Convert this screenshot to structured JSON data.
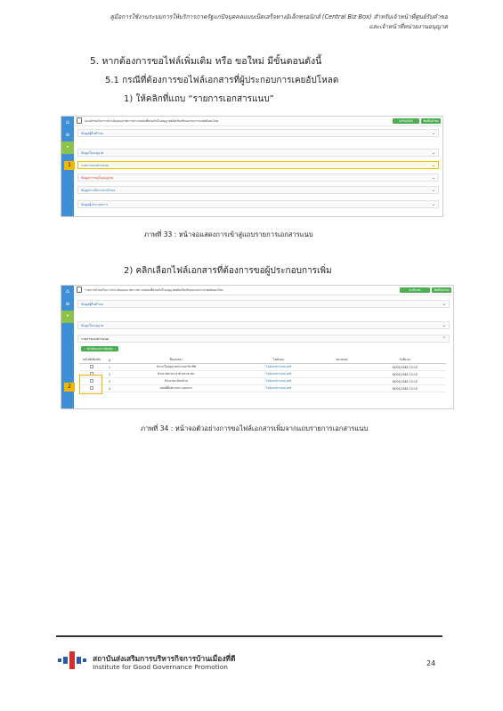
{
  "header": {
    "line1": "คู่มือการใช้งานระบบการให้บริการภาครัฐแก่ปัจบุคคลแบบเบ็ดเสร็จทางอิเล็กทรอนิกส์ (Central Biz Box) สำหรับเจ้าหน้าที่ศูนย์รับคำขอ",
    "line2": "และเจ้าหน้าที่หน่วยงานอนุญาต"
  },
  "sections": {
    "s5": "5. หากต้องการขอไฟล์เพิ่มเติม หรือ ขอใหม่ มีขั้นตอนดังนี้",
    "s51": "5.1 กรณีที่ต้องการขอไฟล์เอกสารที่ผู้ประกอบการเคยอัปโหลด",
    "step1": "1)  ให้คลิกที่แถบ “รายการเอกสารแนบ”",
    "step2": "2)  คลิกเลือกไฟล์เอกสารที่ต้องการขอผู้ประกอบการเพิ่ม"
  },
  "figure33": {
    "caption": "ภาพที่ 33 : หน้าจอแสดงการเข้าสู่แถบรายการเอกสารแนบ",
    "title": "แบบคำขอรับการประเมินคุณภาพการตรวจสอบเพื่อขอรับใบอนุญาตผลิตภัณฑ์ของกรมการแพทย์แผนไทย",
    "buttons": [
      "ส่งเรื่องถัดไป",
      "พิมพ์ใบคำขอ"
    ],
    "step_no": "1",
    "panels": [
      {
        "label": "ข้อมูลผู้ยื่นคำขอ",
        "style": "blue"
      },
      {
        "label": "ข้อมูลใบอนุญาต",
        "style": "blue"
      },
      {
        "label": "รายการเอกสารแนบ",
        "style": "highlight"
      },
      {
        "label": "ข้อมูลการขอใบอนุญาต",
        "style": "red"
      },
      {
        "label": "ข้อมูลการพิจารณาคำขอ",
        "style": "blue"
      },
      {
        "label": "ข้อมูลผู้ประกอบการ",
        "style": "blue"
      }
    ]
  },
  "figure34": {
    "caption": "ภาพที่ 34 : หน้าจอตัวอย่างการขอไฟล์เอกสารเพิ่มจากแถบรายการเอกสารแนบ",
    "title": "รายการคำขอรับการประเมินคุณภาพการตรวจสอบเพื่อขอรับใบอนุญาตผลิตภัณฑ์ของกรมการแพทย์แผนไทย",
    "buttons": [
      "ส่งเรื่องต่อ",
      "พิมพ์ใบคำขอ"
    ],
    "step_no": "2",
    "panels": [
      "ข้อมูลผู้ยื่นคำขอ",
      "ข้อมูลใบอนุญาต",
      "รายการเอกสารแนบ"
    ],
    "action_button": "ขอไฟล์เอกสารเพิ่มเติม",
    "table": {
      "headers": [
        "ขอไฟล์เพิ่มเติม",
        "#",
        "ชื่อเอกสาร",
        "ไฟล์แนบ",
        "หมายเหตุ",
        "วันที่แนบ"
      ],
      "rows": [
        [
          "1",
          "สำเนาใบอนุญาตประกอบวิชาชีพ",
          "ไฟล์เอกสารแนบ.pdf",
          "-",
          "16/05/2562 14:15"
        ],
        [
          "2",
          "สำเนาบัตรประจำตัวประชาชน",
          "ไฟล์เอกสารแนบ.pdf",
          "-",
          "16/05/2562 14:15"
        ],
        [
          "3",
          "สำเนาทะเบียนบ้าน",
          "ไฟล์เอกสารแนบ.pdf",
          "-",
          "16/05/2562 14:15"
        ],
        [
          "4",
          "แผนที่ตั้งสถานประกอบการ",
          "ไฟล์เอกสารแนบ.pdf",
          "-",
          "16/05/2562 14:15"
        ]
      ]
    }
  },
  "footer": {
    "org_th": "สถาบันส่งเสริมการบริหารกิจการบ้านเมืองที่ดี",
    "org_en": "Institute for Good Governance Promotion",
    "page": "24"
  },
  "colors": {
    "sidebar": "#3e8fd6",
    "highlight": "#f0b800",
    "green_button": "#4caf50",
    "link": "#2c6fbf"
  }
}
